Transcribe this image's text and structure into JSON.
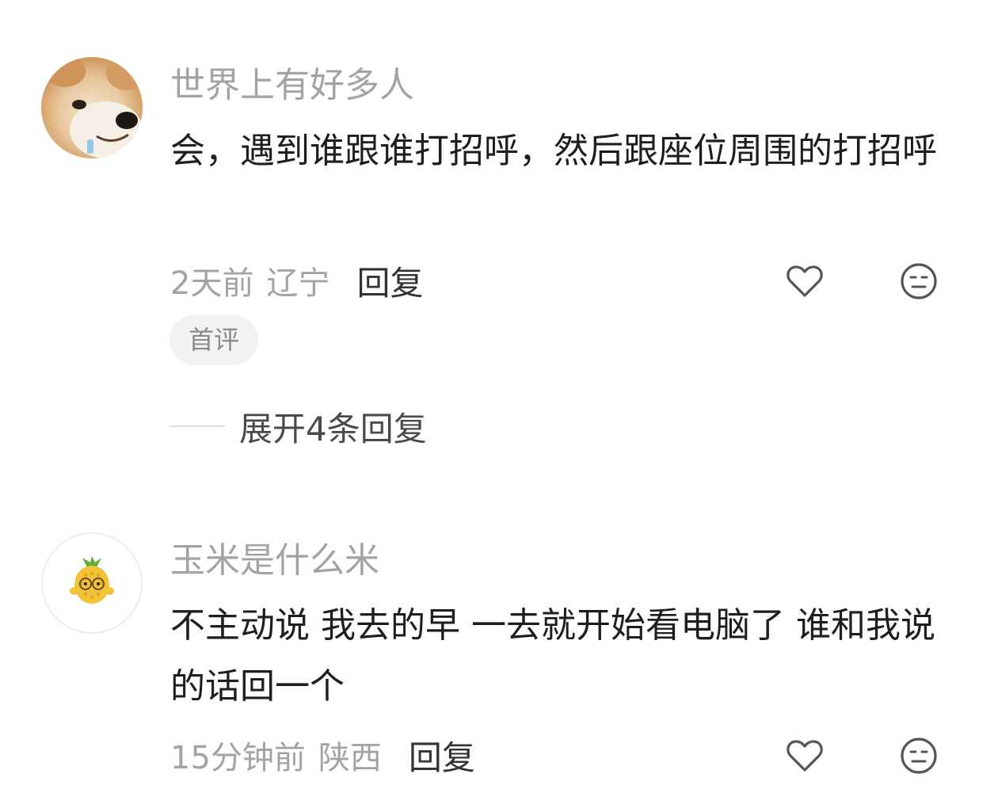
{
  "comments": [
    {
      "username": "世界上有好多人",
      "avatar_icon": "shiba-dog-avatar",
      "text": "会，遇到谁跟谁打招呼，然后跟座位周围的打招呼",
      "time": "2天前",
      "region": "辽宁",
      "reply_label": "回复",
      "like_icon": "heart-outline-icon",
      "dislike_icon": "neutral-face-icon",
      "badge": "首评",
      "expand_label": "展开4条回复"
    },
    {
      "username": "玉米是什么米",
      "avatar_icon": "corn-character-avatar",
      "text": "不主动说 我去的早 一去就开始看电脑了 谁和我说的话回一个",
      "time": "15分钟前",
      "region": "陕西",
      "reply_label": "回复",
      "like_icon": "heart-outline-icon",
      "dislike_icon": "neutral-face-icon"
    }
  ],
  "colors": {
    "username": "#a3a3a3",
    "text": "#1e1e1e",
    "meta": "#a3a3a3",
    "reply": "#333333",
    "badge_bg": "#f2f2f2",
    "icon": "#555555"
  }
}
